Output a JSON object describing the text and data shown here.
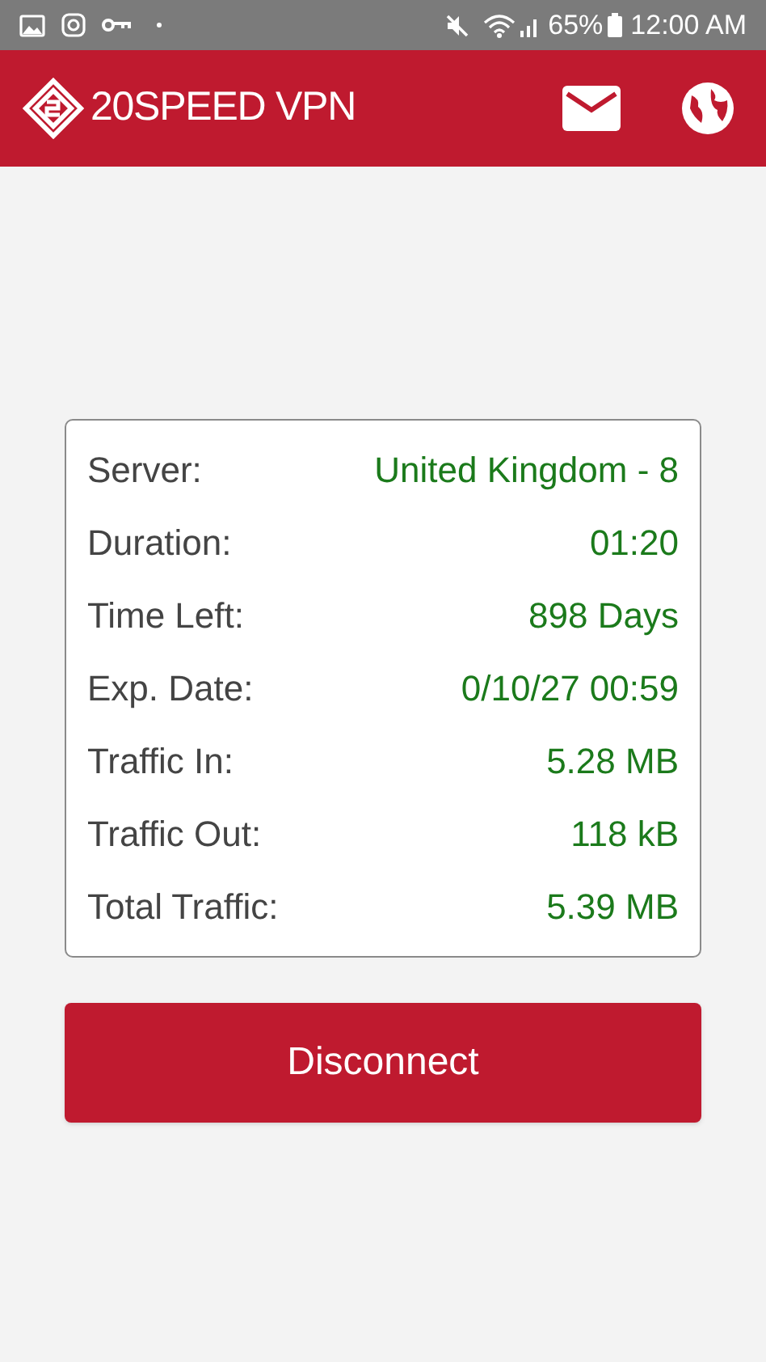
{
  "status_bar": {
    "battery_percent": "65%",
    "time": "12:00 AM"
  },
  "app_bar": {
    "title": "20SPEED VPN"
  },
  "details": [
    {
      "label": "Server:",
      "value": "United Kingdom - 8"
    },
    {
      "label": "Duration:",
      "value": "01:20"
    },
    {
      "label": "Time Left:",
      "value": "898 Days"
    },
    {
      "label": "Exp. Date:",
      "value": "0/10/27 00:59"
    },
    {
      "label": "Traffic In:",
      "value": "5.28 MB"
    },
    {
      "label": "Traffic Out:",
      "value": "118 kB"
    },
    {
      "label": "Total Traffic:",
      "value": "5.39 MB"
    }
  ],
  "disconnect_button": {
    "label": "Disconnect"
  }
}
